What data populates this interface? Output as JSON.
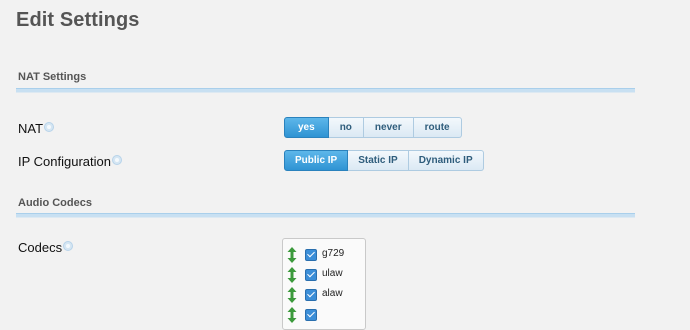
{
  "page": {
    "title": "Edit Settings"
  },
  "nat_section": {
    "heading": "NAT Settings",
    "nat": {
      "label": "NAT",
      "options": [
        "yes",
        "no",
        "never",
        "route"
      ],
      "selected": "yes"
    },
    "ip_config": {
      "label": "IP Configuration",
      "options": [
        "Public IP",
        "Static IP",
        "Dynamic IP"
      ],
      "selected": "Public IP"
    }
  },
  "audio_section": {
    "heading": "Audio Codecs",
    "codecs": {
      "label": "Codecs",
      "items": [
        {
          "name": "g729",
          "checked": true
        },
        {
          "name": "ulaw",
          "checked": true
        },
        {
          "name": "alaw",
          "checked": true
        },
        {
          "name": "",
          "checked": true
        }
      ]
    }
  },
  "icons": {
    "help": "help-icon",
    "drag": "drag-updown-arrow-icon"
  },
  "colors": {
    "accent": "#3498db",
    "divider": "#c8e0f2",
    "drag_arrow": "#3c9a3c"
  }
}
